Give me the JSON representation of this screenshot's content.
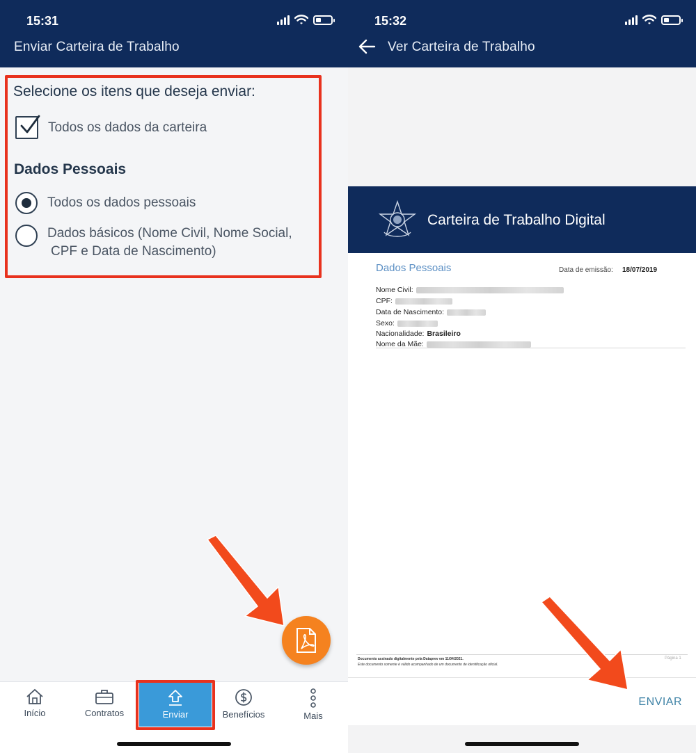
{
  "left_screen": {
    "status": {
      "time": "15:31"
    },
    "title": "Enviar Carteira de Trabalho",
    "select_heading": "Selecione os itens que deseja enviar:",
    "all_card_data": {
      "label": "Todos os dados da carteira",
      "checked": true
    },
    "section_title": "Dados Pessoais",
    "options": [
      {
        "label": "Todos os dados pessoais",
        "selected": true
      },
      {
        "label_line1": "Dados básicos (Nome Civil, Nome Social,",
        "label_line2": "CPF e Data de Nascimento)",
        "selected": false
      }
    ],
    "fab_icon": "pdf-icon",
    "nav": [
      {
        "label": "Início",
        "icon": "home-icon"
      },
      {
        "label": "Contratos",
        "icon": "briefcase-icon"
      },
      {
        "label": "Enviar",
        "icon": "upload-icon",
        "active": true
      },
      {
        "label": "Benefícios",
        "icon": "dollar-icon"
      },
      {
        "label": "Mais",
        "icon": "more-icon"
      }
    ]
  },
  "right_screen": {
    "status": {
      "time": "15:32"
    },
    "title": "Ver Carteira de Trabalho",
    "document": {
      "header_title": "Carteira de Trabalho Digital",
      "section": "Dados Pessoais",
      "emission_label": "Data de emissão:",
      "emission_date": "18/07/2019",
      "fields": {
        "nome_civil": "Nome Civil:",
        "cpf": "CPF:",
        "data_nascimento": "Data de Nascimento:",
        "sexo": "Sexo:",
        "nacionalidade": "Nacionalidade:",
        "nacionalidade_value": "Brasileiro",
        "nome_mae": "Nome da Mãe:"
      },
      "footer_line1": "Documento assinado digitalmente pela Dataprev em 11/04/2021.",
      "footer_line2": "Este documento somente é válido acompanhado de um documento de identificação oficial.",
      "page_label": "Página 1"
    },
    "send_button": "ENVIAR"
  },
  "colors": {
    "navy": "#0f2b5b",
    "highlight_red": "#e8321e",
    "fab_orange": "#f5821f",
    "nav_active_blue": "#3a9ad9",
    "send_blue": "#3f83a6"
  }
}
